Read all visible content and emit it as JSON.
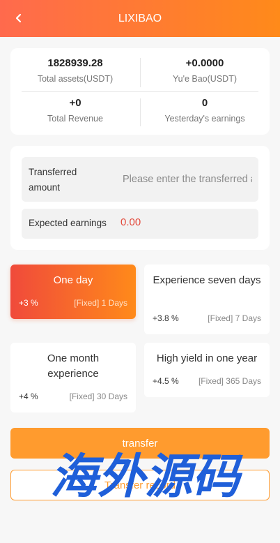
{
  "header": {
    "title": "LIXIBAO",
    "back_icon": "chevron-left-icon"
  },
  "stats": {
    "total_assets": {
      "value": "1828939.28",
      "label": "Total assets(USDT)"
    },
    "yue_bao": {
      "value": "+0.0000",
      "label": "Yu'e Bao(USDT)"
    },
    "total_revenue": {
      "value": "+0",
      "label": "Total Revenue"
    },
    "yesterday": {
      "value": "0",
      "label": "Yesterday's earnings"
    }
  },
  "form": {
    "amount_label": "Transferred amount",
    "amount_placeholder": "Please enter the transferred amount",
    "amount_value": "",
    "earnings_label": "Expected earnings",
    "earnings_value": "0.00"
  },
  "plans": [
    {
      "name": "One day",
      "rate": "+3 %",
      "duration": "[Fixed] 1 Days",
      "selected": true
    },
    {
      "name": "Experience seven days",
      "rate": "+3.8 %",
      "duration": "[Fixed] 7 Days",
      "selected": false
    },
    {
      "name": "One month experience",
      "rate": "+4 %",
      "duration": "[Fixed] 30 Days",
      "selected": false
    },
    {
      "name": "High yield in one year",
      "rate": "+4.5 %",
      "duration": "[Fixed] 365 Days",
      "selected": false
    }
  ],
  "actions": {
    "transfer_label": "transfer",
    "record_label": "Transfer record"
  },
  "watermark": {
    "text": "海外源码"
  },
  "colors": {
    "accent": "#ff9b2e",
    "header_start": "#ff6a4d",
    "header_end": "#ff8a1a",
    "earnings": "#e34a3c",
    "watermark": "#1f5fd9"
  }
}
